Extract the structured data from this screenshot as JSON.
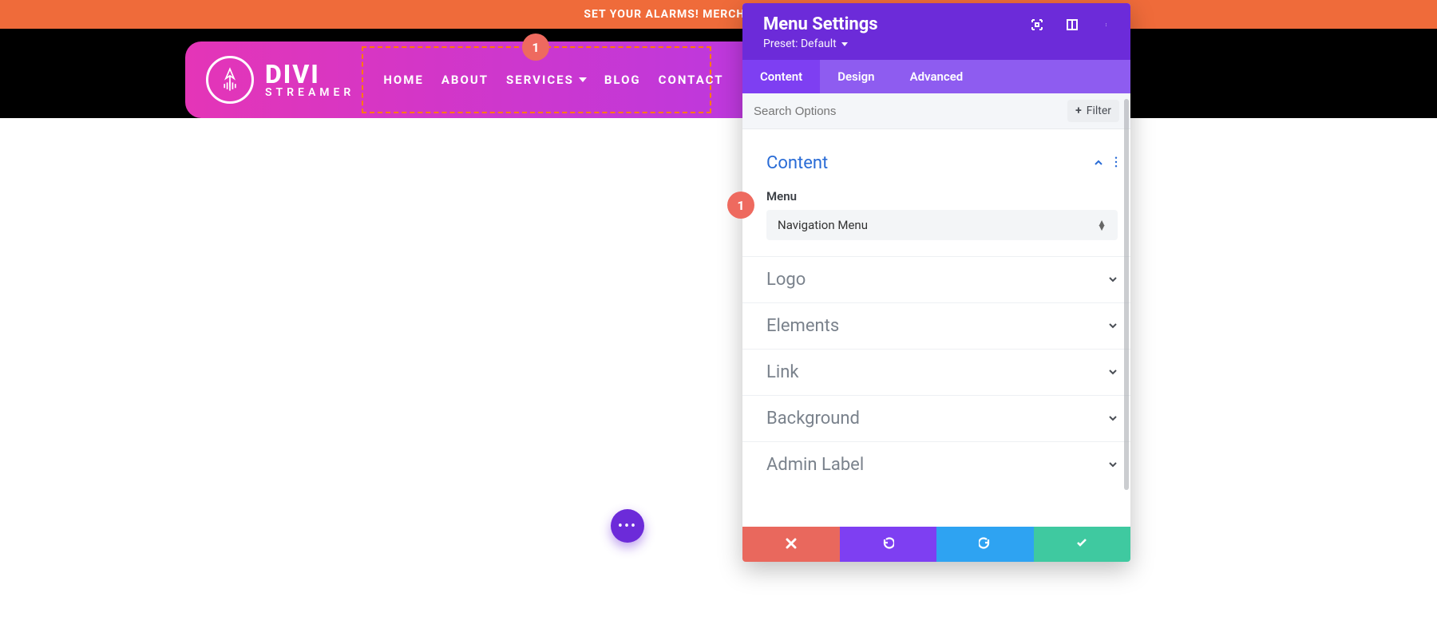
{
  "announcement": {
    "text": "SET YOUR ALARMS! MERCH IS COMING SOON!"
  },
  "logo": {
    "title": "DIVI",
    "subtitle": "STREAMER"
  },
  "nav": {
    "items": [
      {
        "label": "HOME",
        "has_submenu": false
      },
      {
        "label": "ABOUT",
        "has_submenu": false
      },
      {
        "label": "SERVICES",
        "has_submenu": true
      },
      {
        "label": "BLOG",
        "has_submenu": false
      },
      {
        "label": "CONTACT",
        "has_submenu": false
      }
    ]
  },
  "markers": {
    "nav_marker": "1",
    "panel_marker": "1"
  },
  "panel": {
    "title": "Menu Settings",
    "preset_label": "Preset: Default",
    "tabs": {
      "content": "Content",
      "design": "Design",
      "advanced": "Advanced",
      "active": "content"
    },
    "search_placeholder": "Search Options",
    "filter_label": "Filter",
    "content_section": {
      "title": "Content",
      "menu_label": "Menu",
      "menu_selected": "Navigation Menu"
    },
    "sections": {
      "logo": "Logo",
      "elements": "Elements",
      "link": "Link",
      "background": "Background",
      "admin_label": "Admin Label"
    }
  }
}
